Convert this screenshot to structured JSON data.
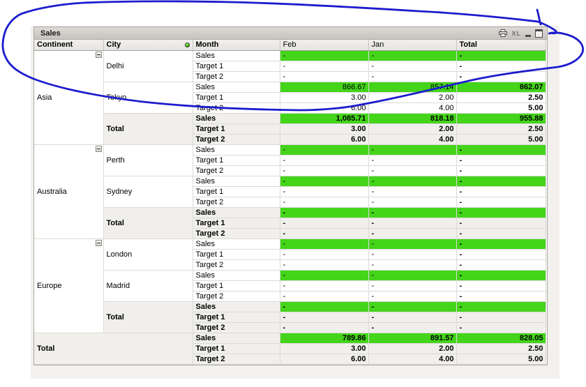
{
  "window": {
    "title": "Sales",
    "caption_icons": {
      "xl_label": "XL"
    }
  },
  "table": {
    "columns": [
      "Continent",
      "City",
      "Month",
      "Feb",
      "Jan",
      "Total"
    ],
    "metrics": [
      "Sales",
      "Target 1",
      "Target 2"
    ],
    "groups": [
      {
        "continent": "Asia",
        "cities": [
          {
            "name": "Delhi",
            "total": false,
            "rows": [
              [
                "Sales",
                "-",
                "-",
                "-"
              ],
              [
                "Target 1",
                "-",
                "-",
                "-"
              ],
              [
                "Target 2",
                "-",
                "-",
                "-"
              ]
            ]
          },
          {
            "name": "Tokyo",
            "total": false,
            "rows": [
              [
                "Sales",
                "866.67",
                "857.14",
                "862.07"
              ],
              [
                "Target 1",
                "3.00",
                "2.00",
                "2.50"
              ],
              [
                "Target 2",
                "6.00",
                "4.00",
                "5.00"
              ]
            ]
          },
          {
            "name": "Total",
            "total": true,
            "rows": [
              [
                "Sales",
                "1,085.71",
                "818.18",
                "955.88"
              ],
              [
                "Target 1",
                "3.00",
                "2.00",
                "2.50"
              ],
              [
                "Target 2",
                "6.00",
                "4.00",
                "5.00"
              ]
            ]
          }
        ]
      },
      {
        "continent": "Australia",
        "cities": [
          {
            "name": "Perth",
            "total": false,
            "rows": [
              [
                "Sales",
                "-",
                "-",
                "-"
              ],
              [
                "Target 1",
                "-",
                "-",
                "-"
              ],
              [
                "Target 2",
                "-",
                "-",
                "-"
              ]
            ]
          },
          {
            "name": "Sydney",
            "total": false,
            "rows": [
              [
                "Sales",
                "-",
                "-",
                "-"
              ],
              [
                "Target 1",
                "-",
                "-",
                "-"
              ],
              [
                "Target 2",
                "-",
                "-",
                "-"
              ]
            ]
          },
          {
            "name": "Total",
            "total": true,
            "rows": [
              [
                "Sales",
                "-",
                "-",
                "-"
              ],
              [
                "Target 1",
                "-",
                "-",
                "-"
              ],
              [
                "Target 2",
                "-",
                "-",
                "-"
              ]
            ]
          }
        ]
      },
      {
        "continent": "Europe",
        "cities": [
          {
            "name": "London",
            "total": false,
            "rows": [
              [
                "Sales",
                "-",
                "-",
                "-"
              ],
              [
                "Target 1",
                "-",
                "-",
                "-"
              ],
              [
                "Target 2",
                "-",
                "-",
                "-"
              ]
            ]
          },
          {
            "name": "Madrid",
            "total": false,
            "rows": [
              [
                "Sales",
                "-",
                "-",
                "-"
              ],
              [
                "Target 1",
                "-",
                "-",
                "-"
              ],
              [
                "Target 2",
                "-",
                "-",
                "-"
              ]
            ]
          },
          {
            "name": "Total",
            "total": true,
            "rows": [
              [
                "Sales",
                "-",
                "-",
                "-"
              ],
              [
                "Target 1",
                "-",
                "-",
                "-"
              ],
              [
                "Target 2",
                "-",
                "-",
                "-"
              ]
            ]
          }
        ]
      }
    ],
    "grand_total": {
      "label": "Total",
      "rows": [
        [
          "Sales",
          "789.86",
          "891.57",
          "828.05"
        ],
        [
          "Target 1",
          "3.00",
          "2.00",
          "2.50"
        ],
        [
          "Target 2",
          "6.00",
          "4.00",
          "5.00"
        ]
      ]
    }
  },
  "colors": {
    "sales_green": "#44d41a",
    "total_row_grey": "#f0efec",
    "annotation_blue": "#1c1ccd"
  }
}
